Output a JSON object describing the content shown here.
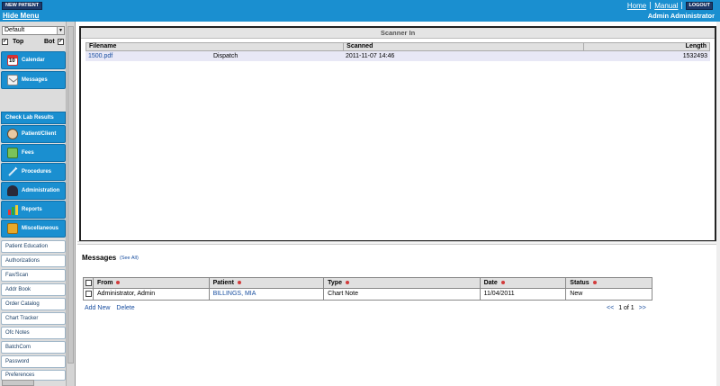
{
  "topbar": {
    "new_patient": "NEW PATIENT",
    "hide_menu": "Hide Menu",
    "home": "Home",
    "manual": "Manual",
    "logout": "LOGOUT",
    "user": "Admin Administrator"
  },
  "sidebar": {
    "profile_select": "Default",
    "top_label": "Top",
    "bot_label": "Bot",
    "nav_main": [
      {
        "label": "Calendar",
        "icon": "calendar-icon"
      },
      {
        "label": "Messages",
        "icon": "envelope-icon"
      },
      {
        "label": "Check Lab Results",
        "icon": ""
      },
      {
        "label": "Patient/Client",
        "icon": "person-icon"
      },
      {
        "label": "Fees",
        "icon": "money-icon"
      },
      {
        "label": "Procedures",
        "icon": "syringe-icon"
      },
      {
        "label": "Administration",
        "icon": "admin-icon"
      },
      {
        "label": "Reports",
        "icon": "chart-icon"
      },
      {
        "label": "Miscellaneous",
        "icon": "puzzle-icon"
      }
    ],
    "calendar_icon_day": "10",
    "nav_links": [
      "Patient Education",
      "Authorizations",
      "Fax/Scan",
      "Addr Book",
      "Order Catalog",
      "Chart Tracker",
      "Ofc Notes",
      "BatchCom",
      "Password",
      "Preferences"
    ]
  },
  "scanner": {
    "title": "Scanner In",
    "columns": [
      "Filename",
      "Scanned",
      "Length"
    ],
    "rows": [
      {
        "filename": "1500.pdf",
        "type": "Dispatch",
        "scanned": "2011-11-07 14:46",
        "length": "1532493"
      }
    ]
  },
  "messages": {
    "title": "Messages",
    "see_all": "(See All)",
    "columns": [
      "From",
      "Patient",
      "Type",
      "Date",
      "Status"
    ],
    "rows": [
      {
        "from": "Administrator, Admin",
        "patient": "BILLINGS, MIA",
        "type": "Chart Note",
        "date": "11/04/2011",
        "status": "New"
      }
    ],
    "add_new": "Add New",
    "delete": "Delete",
    "pager": {
      "prev": "<<",
      "page": "1 of 1",
      "next": ">>"
    }
  },
  "colors": {
    "accent": "#1a8fd0",
    "dark_button": "#1e3a6a",
    "link": "#1a4fa0",
    "sort_dot": "#d23b3b"
  }
}
